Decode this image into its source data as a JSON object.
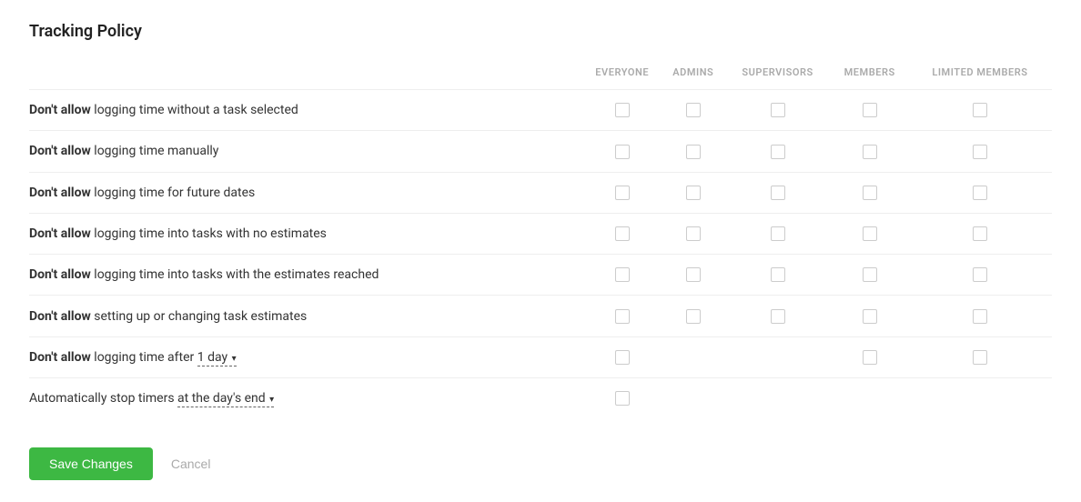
{
  "page": {
    "title": "Tracking Policy"
  },
  "columns": {
    "policy": "",
    "everyone": "Everyone",
    "admins": "Admins",
    "supervisors": "Supervisors",
    "members": "Members",
    "limited_members": "Limited Members"
  },
  "rows": [
    {
      "id": "row-no-task",
      "bold": "Don't allow",
      "normal": " logging time without a task selected",
      "everyone": true,
      "admins": true,
      "supervisors": true,
      "members": true,
      "limited_members": true
    },
    {
      "id": "row-no-manual",
      "bold": "Don't allow",
      "normal": " logging time manually",
      "everyone": true,
      "admins": true,
      "supervisors": true,
      "members": true,
      "limited_members": true
    },
    {
      "id": "row-no-future",
      "bold": "Don't allow",
      "normal": " logging time for future dates",
      "everyone": true,
      "admins": true,
      "supervisors": true,
      "members": true,
      "limited_members": true
    },
    {
      "id": "row-no-estimates",
      "bold": "Don't allow",
      "normal": " logging time into tasks with no estimates",
      "everyone": true,
      "admins": true,
      "supervisors": true,
      "members": true,
      "limited_members": true
    },
    {
      "id": "row-estimates-reached",
      "bold": "Don't allow",
      "normal": " logging time into tasks with the estimates reached",
      "everyone": true,
      "admins": true,
      "supervisors": true,
      "members": true,
      "limited_members": true
    },
    {
      "id": "row-no-change-estimates",
      "bold": "Don't allow",
      "normal": " setting up or changing task estimates",
      "everyone": true,
      "admins": true,
      "supervisors": true,
      "members": true,
      "limited_members": true
    },
    {
      "id": "row-no-log-after",
      "bold": "Don't allow",
      "normal": " logging time after ",
      "dropdown": "1 day",
      "everyone": true,
      "admins": false,
      "supervisors": false,
      "members": true,
      "limited_members": true
    },
    {
      "id": "row-auto-stop",
      "normal": "Automatically stop timers ",
      "dropdown": "at the day's end",
      "everyone": true,
      "admins": false,
      "supervisors": false,
      "members": false,
      "limited_members": false
    }
  ],
  "footer": {
    "save_label": "Save Changes",
    "cancel_label": "Cancel"
  }
}
